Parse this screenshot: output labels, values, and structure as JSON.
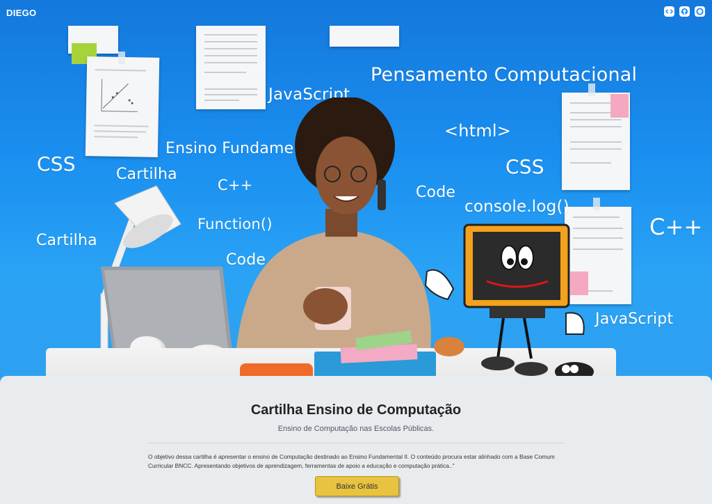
{
  "brand": "DIEGO",
  "header_icons": [
    "code-icon",
    "github-icon",
    "circle-logo-icon"
  ],
  "hero_words": [
    {
      "key": "pensamento",
      "text": "Pensamento Computacional"
    },
    {
      "key": "javascript1",
      "text": "JavaScript"
    },
    {
      "key": "html",
      "text": "<html>"
    },
    {
      "key": "ensino",
      "text": "Ensino Fundamental"
    },
    {
      "key": "css1",
      "text": "CSS"
    },
    {
      "key": "cartilha1",
      "text": "Cartilha"
    },
    {
      "key": "cpp1",
      "text": "C++"
    },
    {
      "key": "css2",
      "text": "CSS"
    },
    {
      "key": "code1",
      "text": "Code"
    },
    {
      "key": "consolelog",
      "text": "console.log()"
    },
    {
      "key": "function",
      "text": "Function()"
    },
    {
      "key": "cpp2",
      "text": "C++"
    },
    {
      "key": "cartilha2",
      "text": "Cartilha"
    },
    {
      "key": "code2",
      "text": "Code"
    },
    {
      "key": "javascript2",
      "text": "JavaScript"
    }
  ],
  "colors": {
    "hero_blue": "#1a8ff0",
    "button_yellow": "#e7c340",
    "page_gray": "#e9ecee"
  },
  "main": {
    "title": "Cartilha Ensino de Computação",
    "subtitle": "Ensino de Computação nas Escolas Públicas.",
    "description": "O objetivo dessa cartilha é apresentar o ensino de Computação destinado ao Ensino Fundamental II. O conteúdo procura estar alinhado com a Base Comum Curricular BNCC. Apresentando objetivos de aprendizagem, ferramentas de apoio a educação e computação prática..\"",
    "button_label": "Baixe Grátis"
  }
}
